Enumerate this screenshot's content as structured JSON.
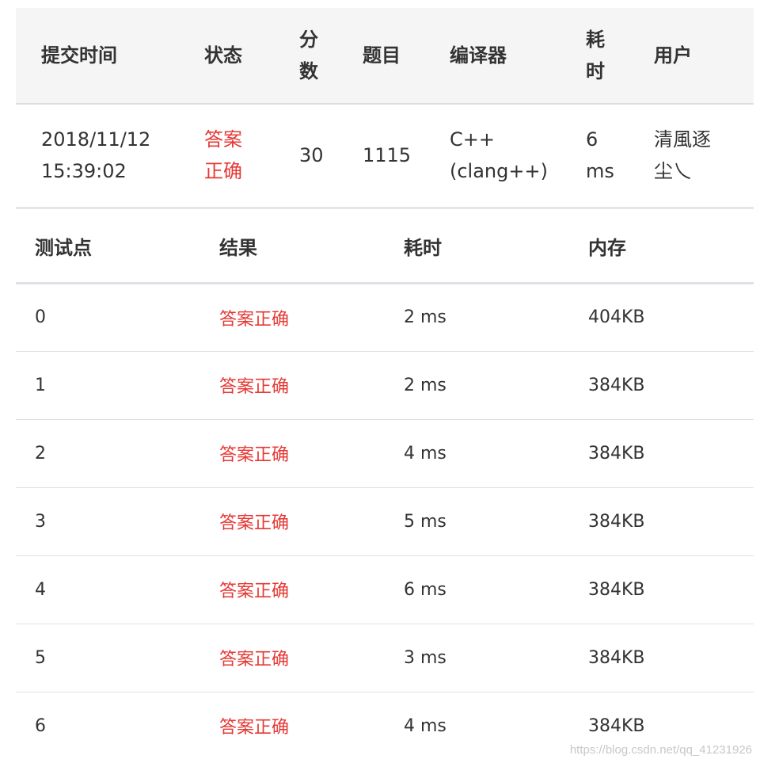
{
  "submission": {
    "headers": {
      "time": "提交时间",
      "status": "状态",
      "score_line1": "分",
      "score_line2": "数",
      "problem": "题目",
      "compiler": "编译器",
      "elapsed_line1": "耗",
      "elapsed_line2": "时",
      "user": "用户"
    },
    "row": {
      "date": "2018/11/12",
      "time": "15:39:02",
      "status_line1": "答案",
      "status_line2": "正确",
      "score": "30",
      "problem": "1115",
      "compiler_line1": "C++",
      "compiler_line2": "(clang++)",
      "elapsed_line1": "6",
      "elapsed_line2": "ms",
      "user_line1": "清風逐",
      "user_line2": "尘乀"
    }
  },
  "testcases": {
    "headers": {
      "case": "测试点",
      "result": "结果",
      "elapsed": "耗时",
      "memory": "内存"
    },
    "rows": [
      {
        "case": "0",
        "result": "答案正确",
        "elapsed": "2 ms",
        "memory": "404KB"
      },
      {
        "case": "1",
        "result": "答案正确",
        "elapsed": "2 ms",
        "memory": "384KB"
      },
      {
        "case": "2",
        "result": "答案正确",
        "elapsed": "4 ms",
        "memory": "384KB"
      },
      {
        "case": "3",
        "result": "答案正确",
        "elapsed": "5 ms",
        "memory": "384KB"
      },
      {
        "case": "4",
        "result": "答案正确",
        "elapsed": "6 ms",
        "memory": "384KB"
      },
      {
        "case": "5",
        "result": "答案正确",
        "elapsed": "3 ms",
        "memory": "384KB"
      },
      {
        "case": "6",
        "result": "答案正确",
        "elapsed": "4 ms",
        "memory": "384KB"
      }
    ]
  },
  "watermark": "https://blog.csdn.net/qq_41231926",
  "colors": {
    "accepted": "#e53935",
    "header_bg": "#f5f5f5",
    "text": "#333333"
  }
}
